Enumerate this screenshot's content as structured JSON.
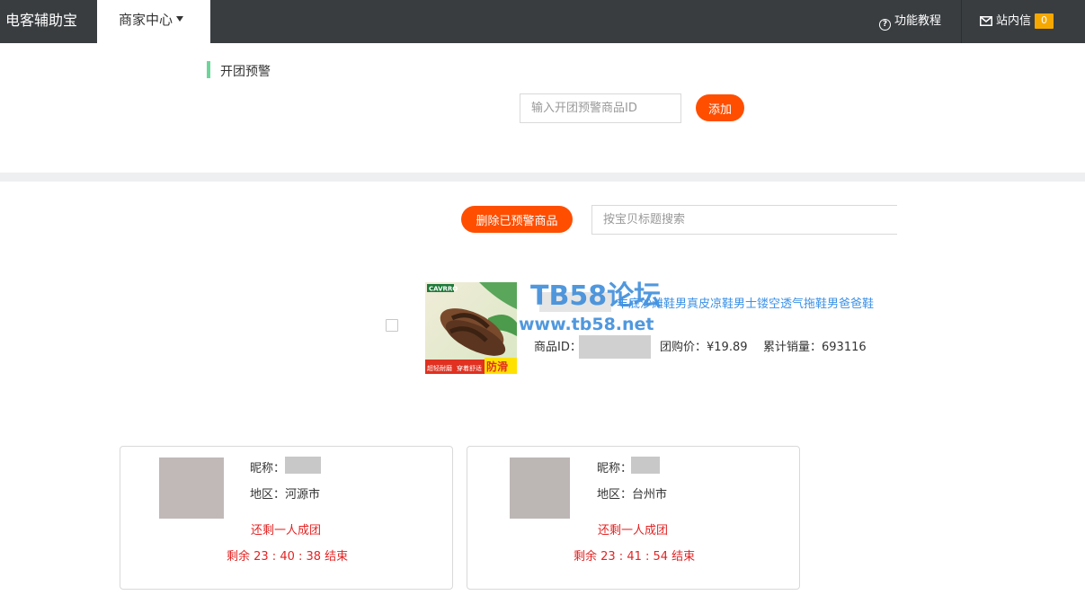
{
  "nav": {
    "brand": "电客辅助宝",
    "merchant_center": "商家中心",
    "tutorial": "功能教程",
    "messages": "站内信",
    "message_count": "0"
  },
  "alert_section": {
    "title": "开团预警",
    "input_placeholder": "输入开团预警商品ID",
    "add_button": "添加"
  },
  "list_section": {
    "delete_button": "删除已预警商品",
    "search_placeholder": "按宝贝标题搜索"
  },
  "product": {
    "title": "丰底沙滩鞋男真皮凉鞋男士镂空透气拖鞋男爸爸鞋",
    "id_label": "商品ID：",
    "price_label": "团购价：",
    "price": "¥19.89",
    "sales_label": "累计销量：",
    "sales": "693116",
    "image_badge": "防滑",
    "image_brand": "CAVRRO",
    "image_text_left": "超轻耐磨",
    "image_text_right": "穿着舒适"
  },
  "watermark": {
    "text": "TB58论坛",
    "url": "www.tb58.net"
  },
  "group_cards": [
    {
      "nickname_label": "昵称：",
      "region_label": "地区：",
      "region": "河源市",
      "remaining": "还剩一人成团",
      "countdown": "剩余 23 : 40 : 38 结束"
    },
    {
      "nickname_label": "昵称：",
      "region_label": "地区：",
      "region": "台州市",
      "remaining": "还剩一人成团",
      "countdown": "剩余 23 : 41 : 54 结束"
    }
  ],
  "colors": {
    "topbar": "#393d40",
    "accent_orange": "#ff4e00",
    "link_blue": "#3c91e6",
    "alert_red": "#e22424",
    "section_mark_green": "#6cd69a",
    "badge_yellow": "#f7a800"
  }
}
